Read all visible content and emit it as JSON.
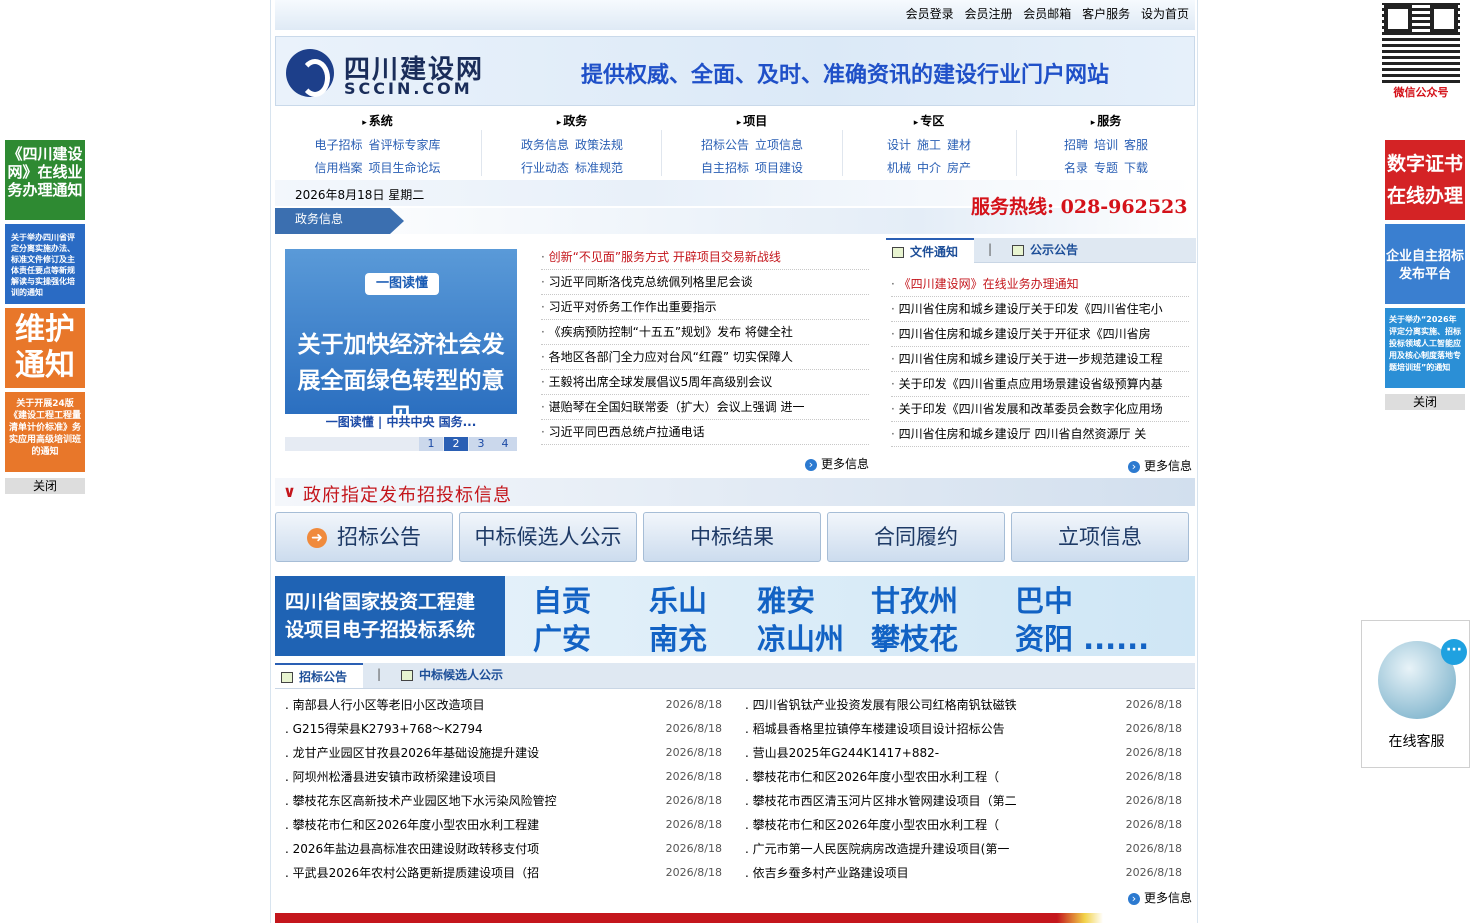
{
  "topbar": {
    "links": [
      "会员登录",
      "会员注册",
      "会员邮箱",
      "客户服务",
      "设为首页"
    ]
  },
  "banner": {
    "site_name": "四川建设网",
    "domain": "SCCIN.COM",
    "slogan": "提供权威、全面、及时、准确资讯的建设行业门户网站"
  },
  "nav": [
    {
      "title": "系统",
      "links": [
        [
          "电子招标",
          "省评标专家库"
        ],
        [
          "信用档案",
          "项目生命论坛"
        ]
      ]
    },
    {
      "title": "政务",
      "links": [
        [
          "政务信息",
          "政策法规"
        ],
        [
          "行业动态",
          "标准规范"
        ]
      ]
    },
    {
      "title": "项目",
      "links": [
        [
          "招标公告",
          "立项信息"
        ],
        [
          "自主招标",
          "项目建设"
        ]
      ]
    },
    {
      "title": "专区",
      "links": [
        [
          "设计",
          "施工",
          "建材"
        ],
        [
          "机械",
          "中介",
          "房产"
        ]
      ]
    },
    {
      "title": "服务",
      "links": [
        [
          "招聘",
          "培训",
          "客服"
        ],
        [
          "名录",
          "专题",
          "下载"
        ]
      ]
    }
  ],
  "date": "2026年8月18日 星期二",
  "hotline": "服务热线: 028-962523",
  "gov_tab": "政务信息",
  "slide": {
    "tag": "一图读懂",
    "title": "关于加快经济社会发展全面绿色转型的意见",
    "caption": "一图读懂 | 中共中央 国务...",
    "pages": [
      "1",
      "2",
      "3",
      "4"
    ],
    "active_page": 2
  },
  "news": [
    "创新“不见面”服务方式 开辟项目交易新战线",
    "习近平同斯洛伐克总统佩列格里尼会谈",
    "习近平对侨务工作作出重要指示",
    "《疾病预防控制“十五五”规划》发布 将健全社",
    "各地区各部门全力应对台风“红霞” 切实保障人",
    "王毅将出席全球发展倡议5周年高级别会议",
    "谌贻琴在全国妇联常委（扩大）会议上强调 进一",
    "习近平同巴西总统卢拉通电话"
  ],
  "more_label": "更多信息",
  "right_tabs": [
    "文件通知",
    "公示公告"
  ],
  "notices": [
    "《四川建设网》在线业务办理通知",
    "四川省住房和城乡建设厅关于印发《四川省住宅小",
    "四川省住房和城乡建设厅关于开征求《四川省房",
    "四川省住房和城乡建设厅关于进一步规范建设工程",
    "关于印发《四川省重点应用场景建设省级预算内基",
    "关于印发《四川省发展和改革委员会数字化应用场",
    "四川省住房和城乡建设厅 四川省自然资源厅 关"
  ],
  "bid_head": "政府指定发布招投标信息",
  "big_buttons": [
    "招标公告",
    "中标候选人公示",
    "中标结果",
    "合同履约",
    "立项信息"
  ],
  "cities_banner": {
    "title_lines": [
      "四川省国家投资工程建",
      "设项目电子招投标系统"
    ],
    "cities": [
      "自贡",
      "乐山",
      "雅安",
      "甘孜州",
      "巴中",
      "广安",
      "南充",
      "凉山州",
      "攀枝花",
      "资阳 ......"
    ]
  },
  "bottom_tabs": [
    "招标公告",
    "中标候选人公示"
  ],
  "bids_left": [
    {
      "title": "南部县人行小区等老旧小区改造项目",
      "date": "2026/8/18"
    },
    {
      "title": "G215得荣县K2793+768～K2794",
      "date": "2026/8/18"
    },
    {
      "title": "龙甘产业园区甘孜县2026年基础设施提升建设",
      "date": "2026/8/18"
    },
    {
      "title": "阿坝州松潘县进安镇市政桥梁建设项目",
      "date": "2026/8/18"
    },
    {
      "title": "攀枝花东区高新技术产业园区地下水污染风险管控",
      "date": "2026/8/18"
    },
    {
      "title": "攀枝花市仁和区2026年度小型农田水利工程建",
      "date": "2026/8/18"
    },
    {
      "title": "2026年盐边县高标准农田建设财政转移支付项",
      "date": "2026/8/18"
    },
    {
      "title": "平武县2026年农村公路更新提质建设项目（招",
      "date": "2026/8/18"
    }
  ],
  "bids_right": [
    {
      "title": "四川省钒钛产业投资发展有限公司红格南钒钛磁铁",
      "date": "2026/8/18"
    },
    {
      "title": "稻城县香格里拉镇停车楼建设项目设计招标公告",
      "date": "2026/8/18"
    },
    {
      "title": "营山县2025年G244K1417+882-",
      "date": "2026/8/18"
    },
    {
      "title": "攀枝花市仁和区2026年度小型农田水利工程（",
      "date": "2026/8/18"
    },
    {
      "title": "攀枝花市西区清玉河片区排水管网建设项目（第二",
      "date": "2026/8/18"
    },
    {
      "title": "攀枝花市仁和区2026年度小型农田水利工程（",
      "date": "2026/8/18"
    },
    {
      "title": "广元市第一人民医院病房改造提升建设项目(第一",
      "date": "2026/8/18"
    },
    {
      "title": "依吉乡蚕多村产业路建设项目",
      "date": "2026/8/18"
    }
  ],
  "left_ads": [
    "《四川建设网》在线业务办理通知",
    "关于举办四川省评定分离实施办法、标准文件修订及主体责任要点等新规解读与实操强化培训的通知",
    "维护通知",
    "关于开展24版《建设工程工程量清单计价标准》务实应用高级培训班的通知"
  ],
  "right_ads": [
    "数字证书在线办理",
    "企业自主招标发布平台",
    "关于举办“2026年评定分离实施、招标投标领域人工智能应用及核心制度落地专题培训班”的通知"
  ],
  "close_label": "关闭",
  "qr_label": "微信公众号",
  "cs_label": "在线客服",
  "colors": {
    "accent_blue": "#2a5fb4",
    "red": "#c4161c"
  }
}
